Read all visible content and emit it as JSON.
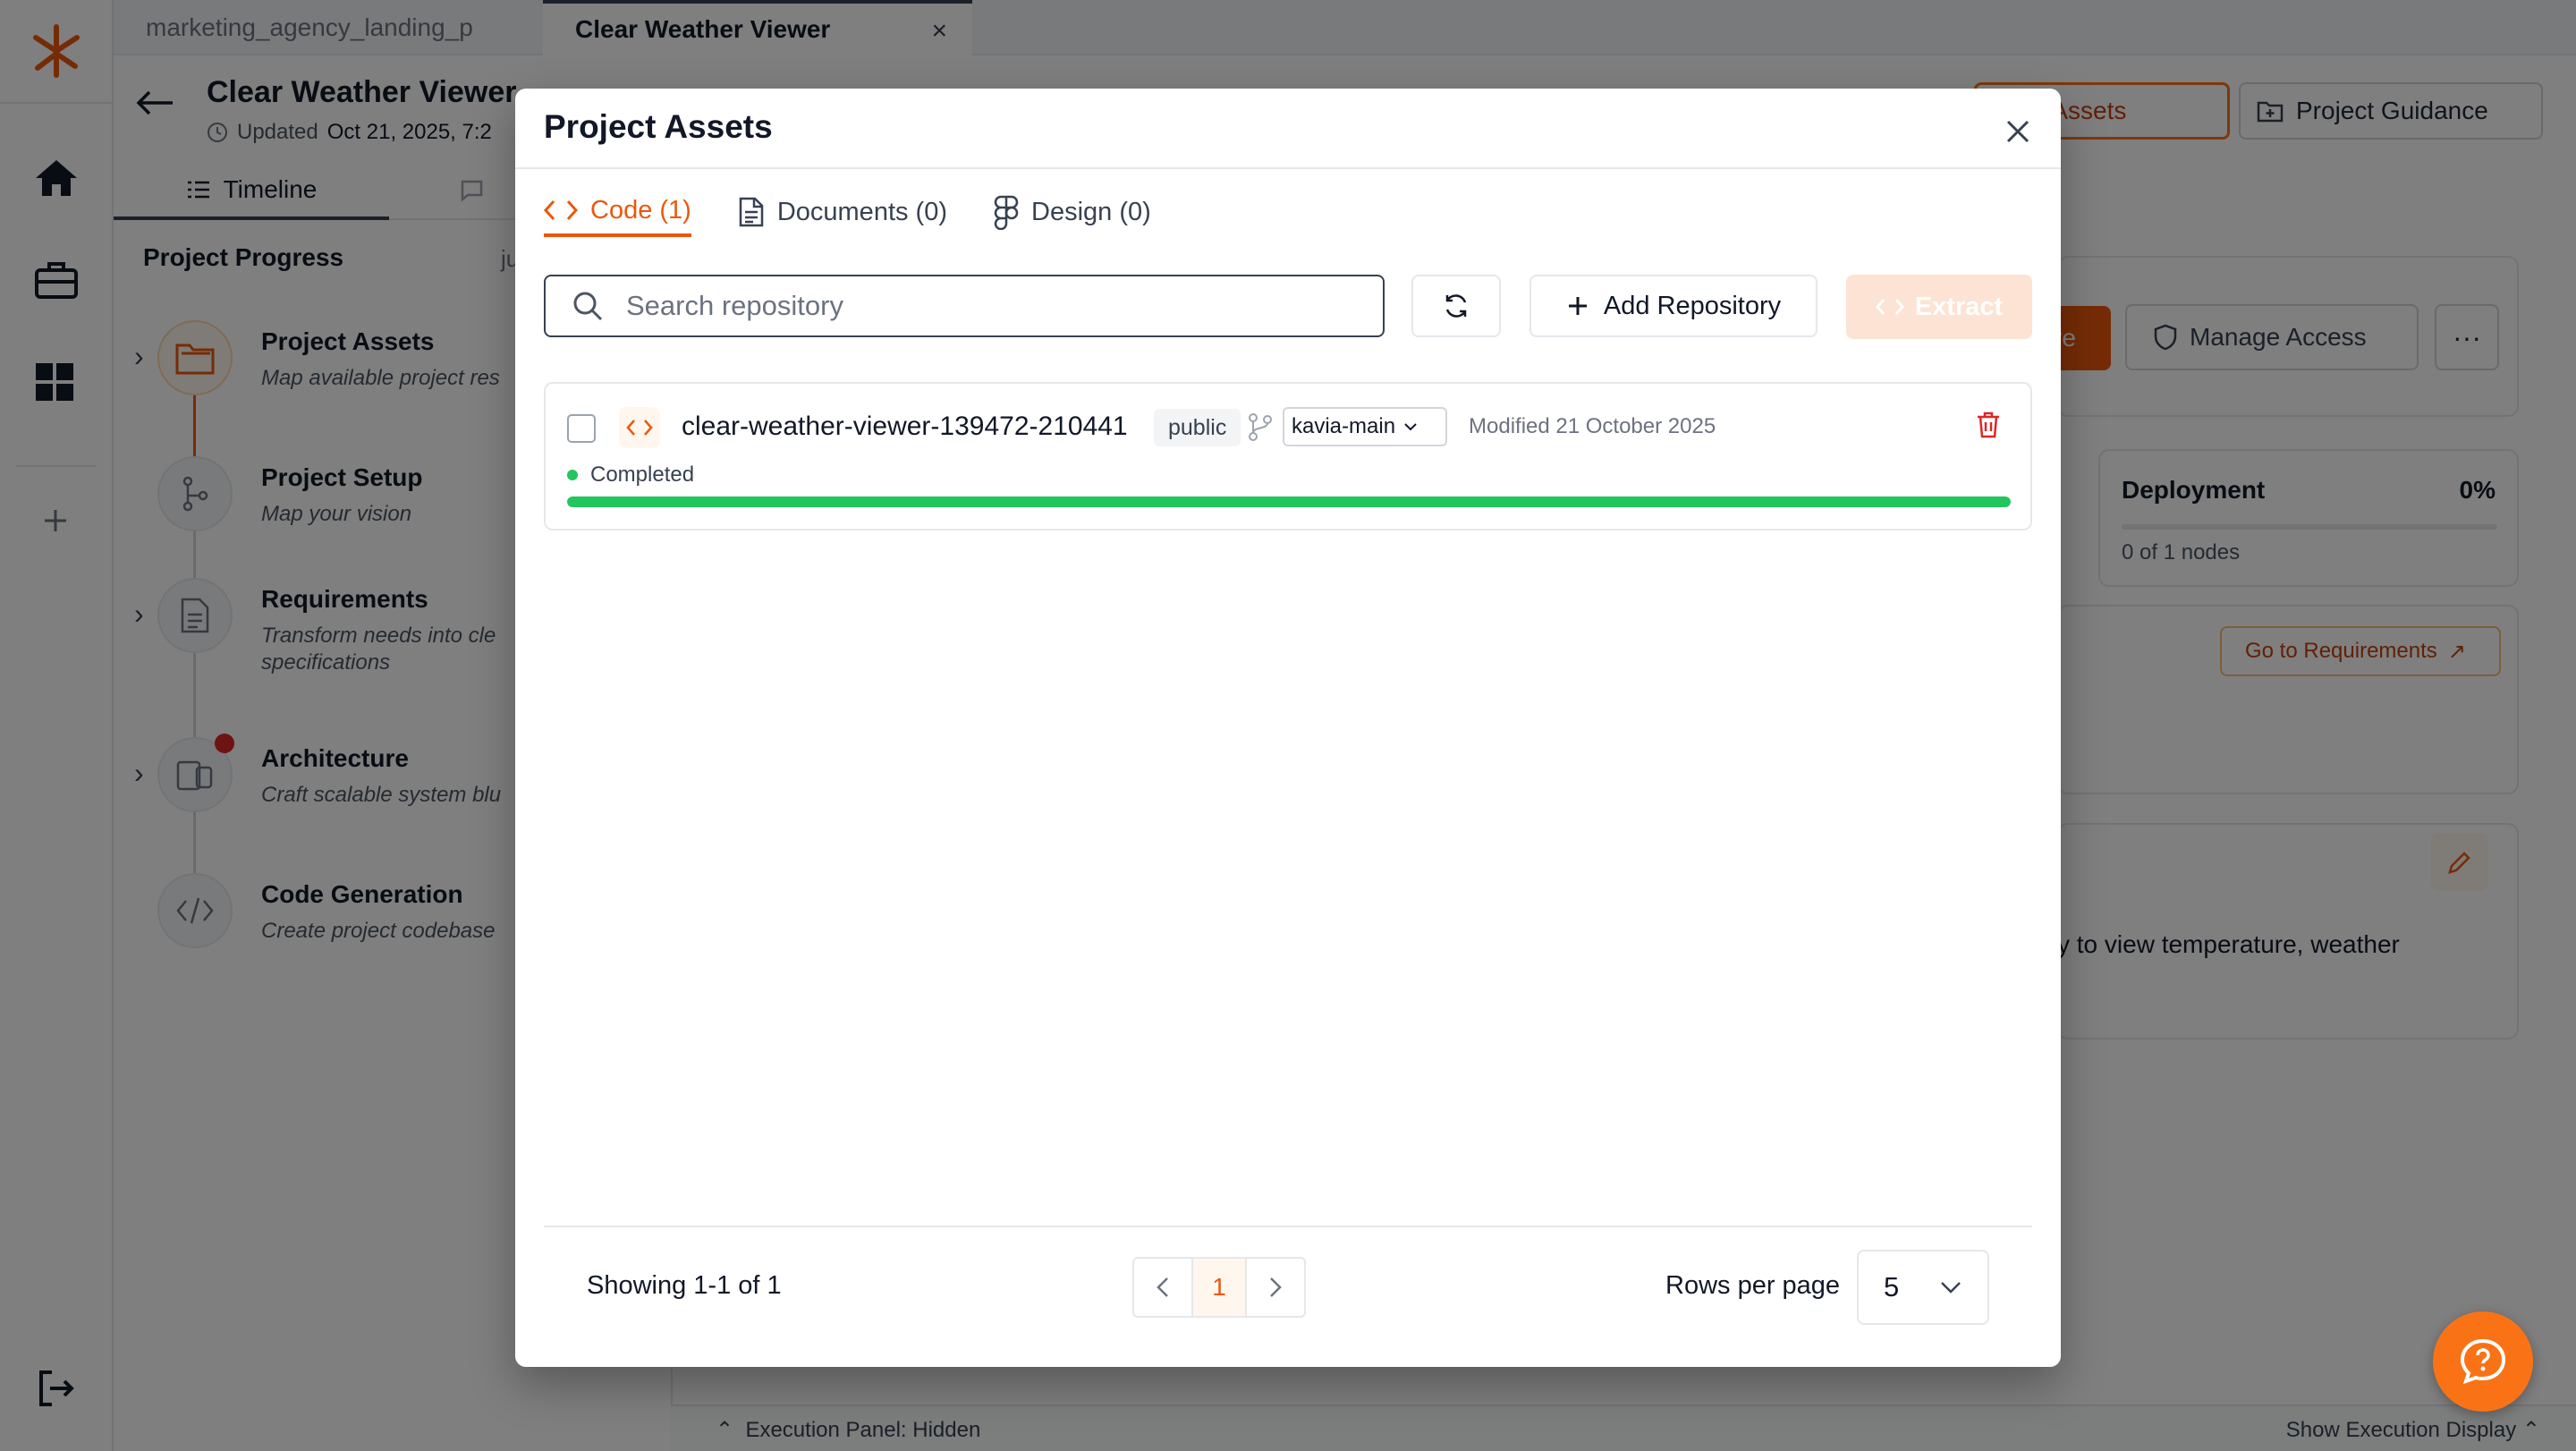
{
  "browser_tabs": [
    {
      "label": "marketing_agency_landing_p",
      "active": false
    },
    {
      "label": "Clear Weather Viewer",
      "active": true
    }
  ],
  "project": {
    "title": "Clear Weather Viewer",
    "updated_label": "Updated",
    "updated_value": "Oct 21, 2025, 7:2"
  },
  "header_buttons": {
    "assets": "oject Assets",
    "guidance": "Project Guidance"
  },
  "left_panel": {
    "tab_timeline": "Timeline",
    "progress_title": "Project Progress",
    "progress_right": "ju",
    "steps": [
      {
        "title": "Project Assets",
        "desc": "Map available project res"
      },
      {
        "title": "Project Setup",
        "desc": "Map your vision"
      },
      {
        "title": "Requirements",
        "desc": "Transform needs into cle specifications"
      },
      {
        "title": "Architecture",
        "desc": "Craft scalable system blu"
      },
      {
        "title": "Code Generation",
        "desc": "Create project codebase"
      }
    ]
  },
  "right_panel": {
    "orange_btn": "re",
    "manage_access": "Manage Access",
    "deployment_title": "Deployment",
    "deployment_pct": "0%",
    "deployment_nodes": "0 of 1 nodes",
    "go_requirements": "Go to Requirements",
    "description_fragment": "y to view temperature, weather"
  },
  "exec_bar": {
    "left": "Execution Panel: Hidden",
    "right": "Show Execution Display"
  },
  "modal": {
    "title": "Project Assets",
    "tabs": [
      {
        "label": "Code (1)",
        "icon": "code-icon",
        "active": true
      },
      {
        "label": "Documents (0)",
        "icon": "document-icon",
        "active": false
      },
      {
        "label": "Design (0)",
        "icon": "figma-icon",
        "active": false
      }
    ],
    "search_placeholder": "Search repository",
    "add_repository": "Add Repository",
    "extract": "Extract",
    "repositories": [
      {
        "name": "clear-weather-viewer-139472-210441",
        "visibility": "public",
        "branch": "kavia-main",
        "modified": "Modified 21 October 2025",
        "status": "Completed",
        "progress": 1.0
      }
    ],
    "footer": {
      "showing": "Showing 1-1 of 1",
      "current_page": "1",
      "rows_label": "Rows per page",
      "rows_value": "5"
    }
  },
  "colors": {
    "accent": "#ea580c",
    "success": "#22c55e",
    "danger": "#dc2626"
  }
}
